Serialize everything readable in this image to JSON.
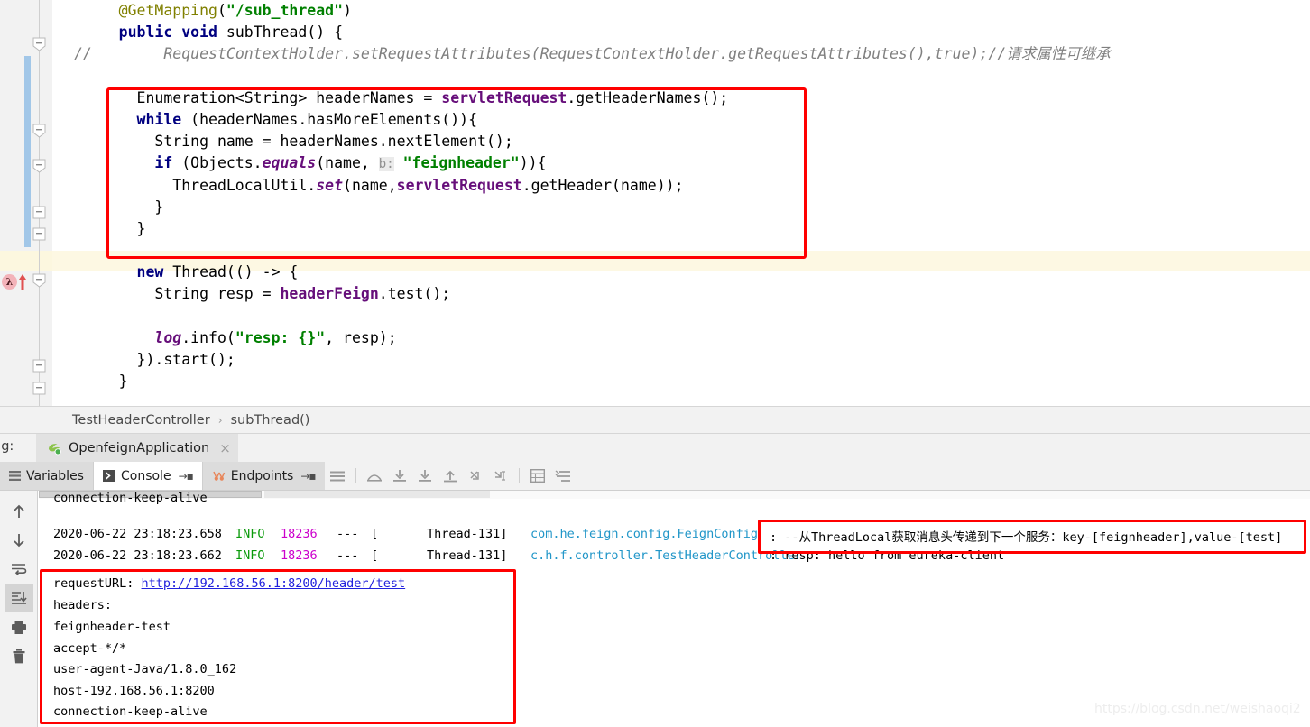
{
  "editor": {
    "code_lines": [
      {
        "indent": 5,
        "tokens": [
          {
            "t": "@GetMapping",
            "c": "an"
          },
          {
            "t": "(",
            "c": ""
          },
          {
            "t": "\"/sub_thread\"",
            "c": "s"
          },
          {
            "t": ")",
            "c": ""
          }
        ]
      },
      {
        "indent": 5,
        "tokens": [
          {
            "t": "public",
            "c": "k"
          },
          {
            "t": " ",
            "c": ""
          },
          {
            "t": "void",
            "c": "k"
          },
          {
            "t": " subThread() {",
            "c": ""
          }
        ]
      },
      {
        "indent": 0,
        "tokens": [
          {
            "t": "//",
            "c": "cm"
          },
          {
            "t": "        RequestContextHolder.setRequestAttributes(RequestContextHolder.getRequestAttributes(),true);//请求属性可继承",
            "c": "cm"
          }
        ]
      },
      {
        "indent": 0,
        "tokens": []
      },
      {
        "indent": 7,
        "tokens": [
          {
            "t": "Enumeration<String> headerNames = ",
            "c": ""
          },
          {
            "t": "servletRequest",
            "c": "f"
          },
          {
            "t": ".getHeaderNames();",
            "c": ""
          }
        ]
      },
      {
        "indent": 7,
        "tokens": [
          {
            "t": "while",
            "c": "k"
          },
          {
            "t": " (headerNames.hasMoreElements()){",
            "c": ""
          }
        ]
      },
      {
        "indent": 9,
        "tokens": [
          {
            "t": "String name = headerNames.nextElement();",
            "c": ""
          }
        ]
      },
      {
        "indent": 9,
        "tokens": [
          {
            "t": "if",
            "c": "k"
          },
          {
            "t": " (Objects.",
            "c": ""
          },
          {
            "t": "equals",
            "c": "st"
          },
          {
            "t": "(name, ",
            "c": ""
          },
          {
            "t": "b:",
            "c": "hint"
          },
          {
            "t": " ",
            "c": ""
          },
          {
            "t": "\"feignheader\"",
            "c": "s"
          },
          {
            "t": ")){",
            "c": ""
          }
        ]
      },
      {
        "indent": 11,
        "tokens": [
          {
            "t": "ThreadLocalUtil.",
            "c": ""
          },
          {
            "t": "set",
            "c": "st"
          },
          {
            "t": "(name,",
            "c": ""
          },
          {
            "t": "servletRequest",
            "c": "f"
          },
          {
            "t": ".getHeader(name));",
            "c": ""
          }
        ]
      },
      {
        "indent": 9,
        "tokens": [
          {
            "t": "}",
            "c": ""
          }
        ]
      },
      {
        "indent": 7,
        "tokens": [
          {
            "t": "}",
            "c": ""
          }
        ]
      },
      {
        "indent": 0,
        "tokens": []
      },
      {
        "indent": 7,
        "tokens": [
          {
            "t": "new",
            "c": "k"
          },
          {
            "t": " Thread(() -> {",
            "c": ""
          }
        ]
      },
      {
        "indent": 9,
        "tokens": [
          {
            "t": "String resp = ",
            "c": ""
          },
          {
            "t": "headerFeign",
            "c": "f"
          },
          {
            "t": ".test();",
            "c": ""
          }
        ]
      },
      {
        "indent": 0,
        "tokens": []
      },
      {
        "indent": 9,
        "tokens": [
          {
            "t": "log",
            "c": "st"
          },
          {
            "t": ".info(",
            "c": ""
          },
          {
            "t": "\"resp: {}\"",
            "c": "s"
          },
          {
            "t": ", resp);",
            "c": ""
          }
        ]
      },
      {
        "indent": 7,
        "tokens": [
          {
            "t": "}).start();",
            "c": ""
          }
        ]
      },
      {
        "indent": 5,
        "tokens": [
          {
            "t": "}",
            "c": ""
          }
        ]
      }
    ]
  },
  "breadcrumb": {
    "class_name": "TestHeaderController",
    "separator": "›",
    "method_name": "subThread()"
  },
  "run_bar": {
    "debug_label": "ug:",
    "tab_label": "OpenfeignApplication",
    "close_label": "×"
  },
  "tool_tabs": {
    "variables": "Variables",
    "console": "Console",
    "endpoints": "Endpoints",
    "pin_glyph": "→▪"
  },
  "console_sidebar": {
    "items": [
      {
        "name": "up-icon",
        "title": "Up the Stack Trace"
      },
      {
        "name": "down-icon",
        "title": "Down the Stack Trace"
      },
      {
        "name": "soft-wrap-icon",
        "title": "Soft-Wrap"
      },
      {
        "name": "scroll-to-end-icon",
        "title": "Scroll to End"
      },
      {
        "name": "print-icon",
        "title": "Print"
      },
      {
        "name": "trash-icon",
        "title": "Clear All"
      }
    ]
  },
  "console": {
    "partial_top_line": "connection-keep-alive",
    "log_entries": [
      {
        "timestamp": "2020-06-22 23:18:23.658",
        "level": "INFO",
        "pid": "18236",
        "dashes": "---",
        "thread": "Thread-131",
        "logger": "com.he.feign.config.FeignConfig",
        "message": ": --从ThreadLocal获取消息头传递到下一个服务：key-[feignheader],value-[test]"
      },
      {
        "timestamp": "2020-06-22 23:18:23.662",
        "level": "INFO",
        "pid": "18236",
        "dashes": "---",
        "thread": "Thread-131",
        "logger": "c.h.f.controller.TestHeaderController",
        "message": ": resp: hello from eureka-client"
      }
    ],
    "request_block": {
      "url_label": "requestURL: ",
      "url": "http://192.168.56.1:8200/header/test",
      "headers_label": "headers:",
      "headers": [
        "feignheader-test",
        "accept-*/*",
        "user-agent-Java/1.8.0_162",
        "host-192.168.56.1:8200",
        "connection-keep-alive"
      ]
    }
  },
  "watermark": "https://blog.csdn.net/weishaoqi2",
  "colors": {
    "annotation_highlight": "#ff0000",
    "keyword": "#000080",
    "string": "#008000",
    "field": "#660e7a",
    "comment": "#808080",
    "info_level": "#0a9a0a",
    "pid": "#cc00cc",
    "logger": "#2196c8",
    "link": "#2222dd",
    "highlight_band": "#fdf8e3",
    "change_bar": "#a2c7e8"
  }
}
